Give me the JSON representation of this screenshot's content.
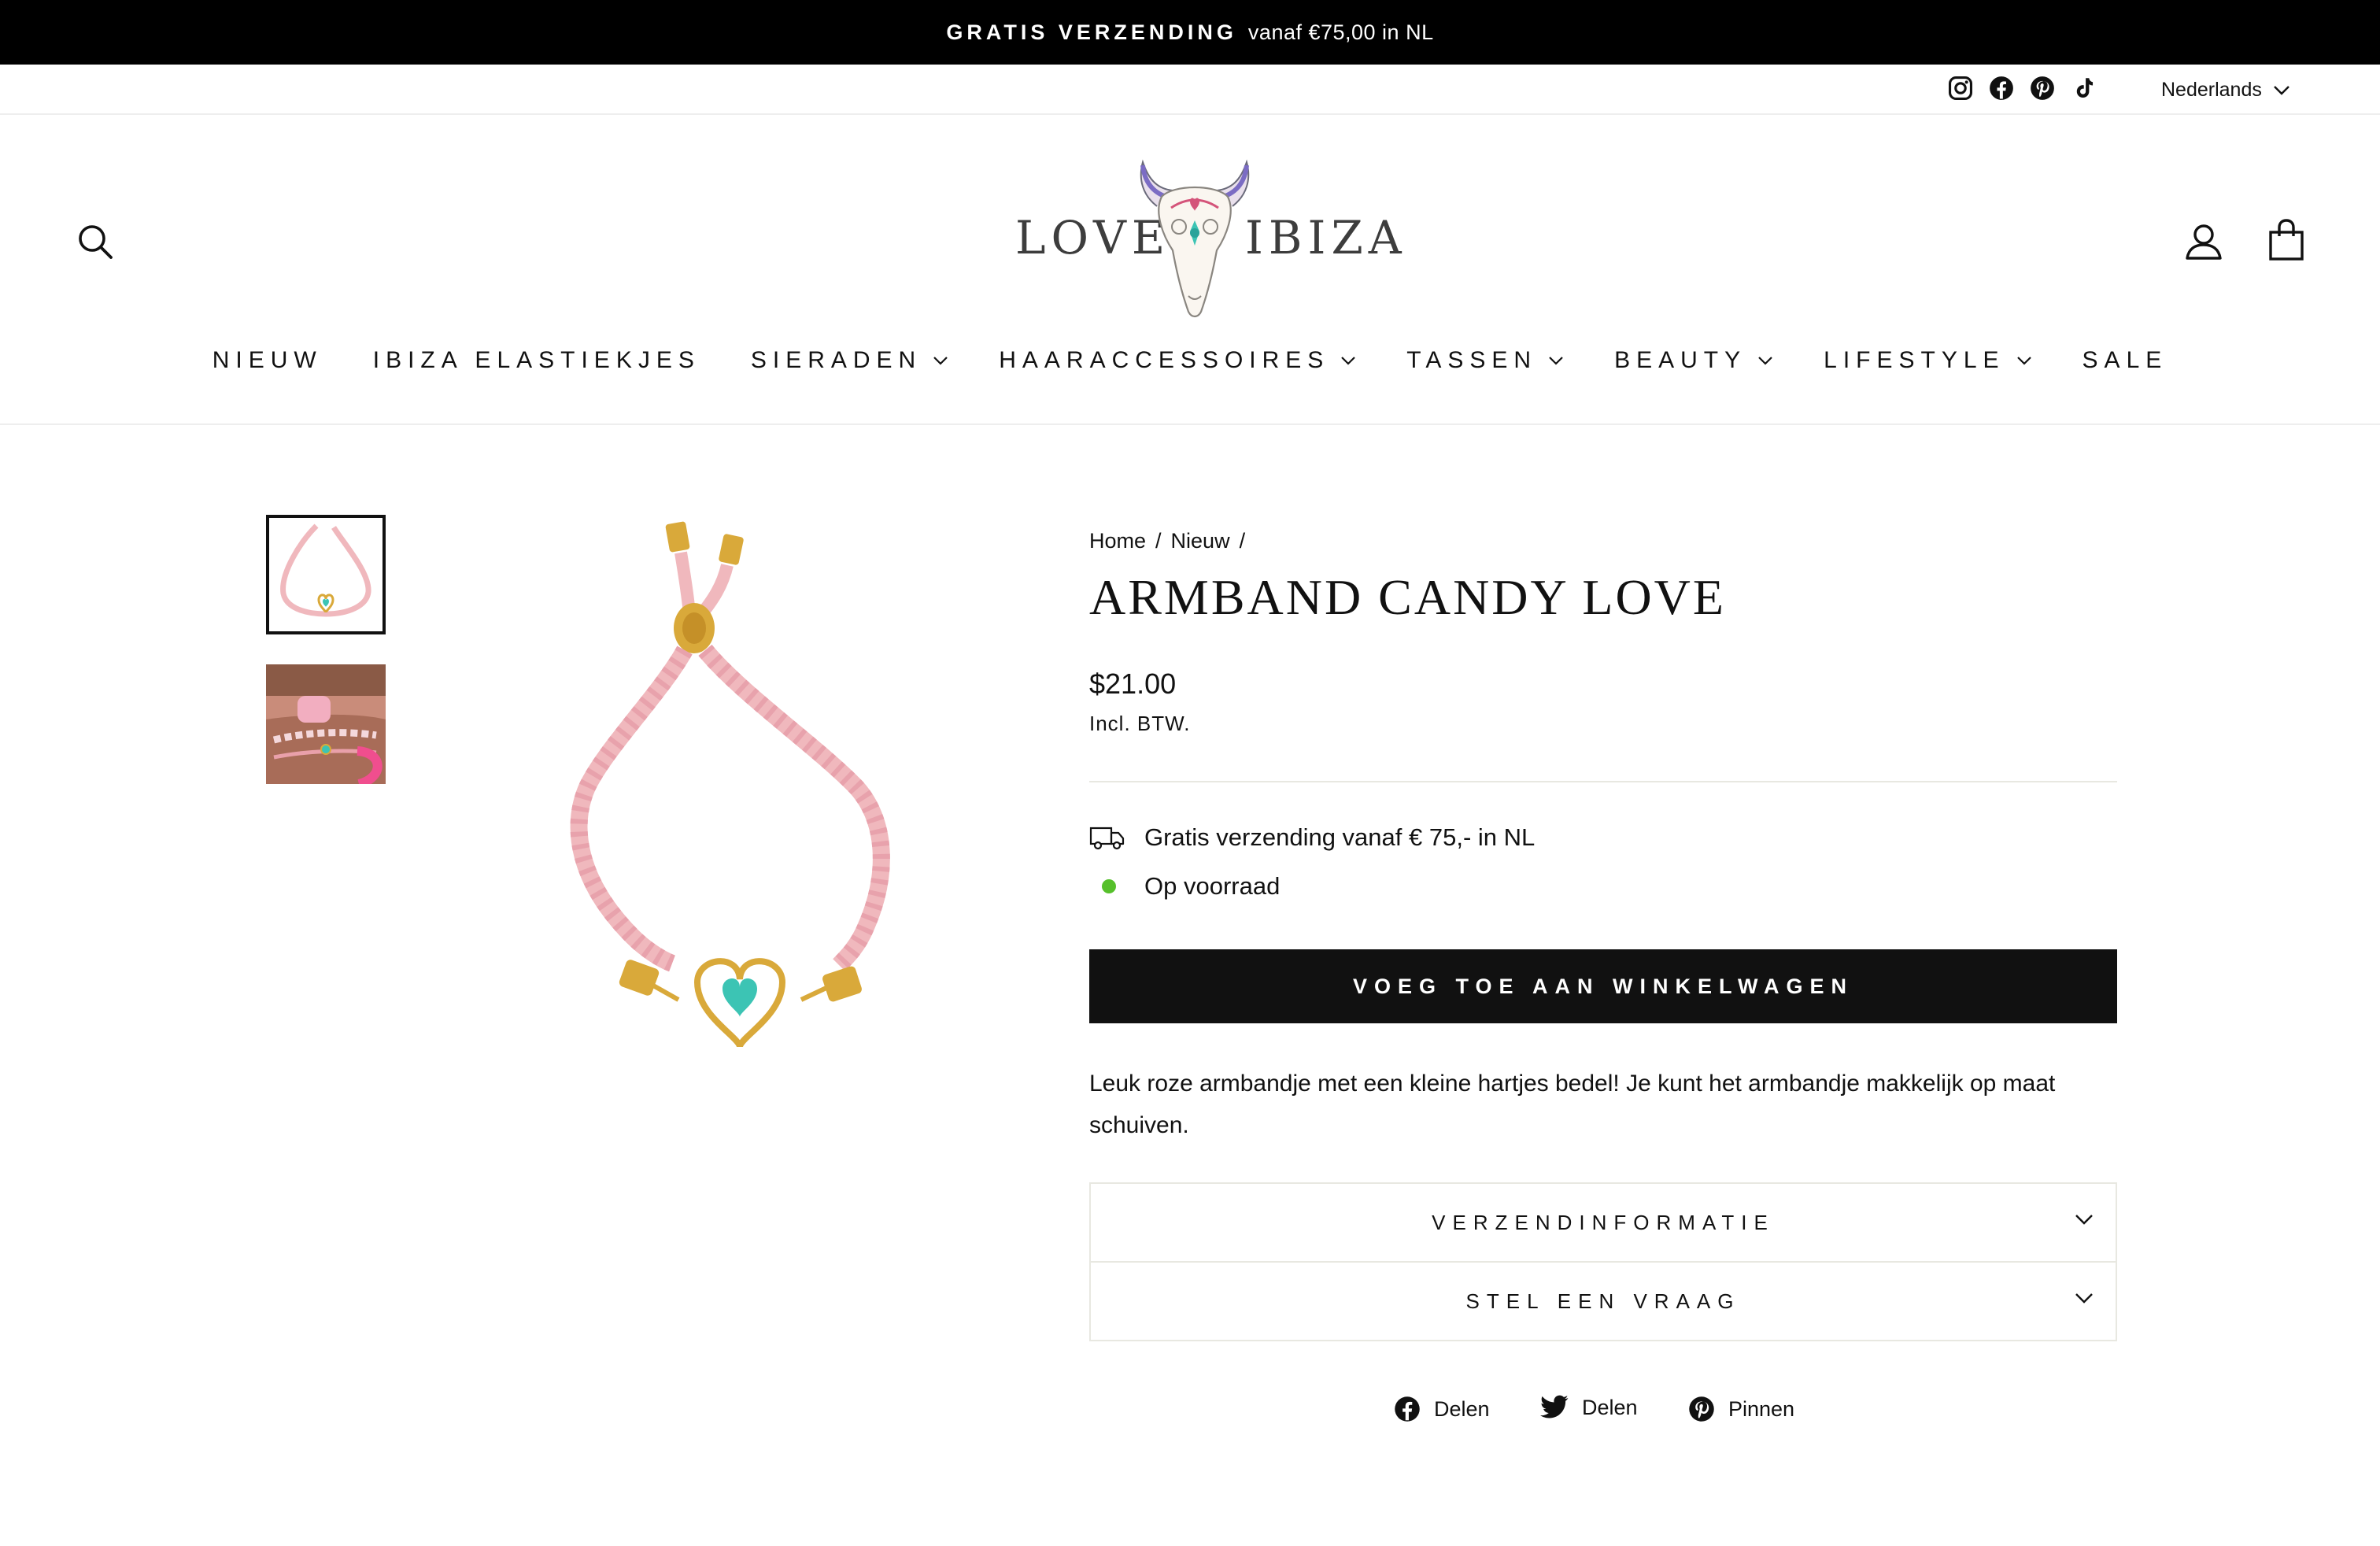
{
  "announcement": {
    "strong": "GRATIS VERZENDING",
    "rest": "vanaf €75,00 in NL"
  },
  "utility": {
    "social_icons": [
      "instagram-icon",
      "facebook-icon",
      "pinterest-icon",
      "tiktok-icon"
    ],
    "language": "Nederlands"
  },
  "header": {
    "logo_left": "LOVE",
    "logo_right": "IBIZA",
    "icons": [
      "search-icon",
      "account-icon",
      "cart-icon"
    ]
  },
  "nav": {
    "items": [
      {
        "label": "NIEUW",
        "dropdown": false
      },
      {
        "label": "IBIZA ELASTIEKJES",
        "dropdown": false
      },
      {
        "label": "SIERADEN",
        "dropdown": true
      },
      {
        "label": "HAARACCESSOIRES",
        "dropdown": true
      },
      {
        "label": "TASSEN",
        "dropdown": true
      },
      {
        "label": "BEAUTY",
        "dropdown": true
      },
      {
        "label": "LIFESTYLE",
        "dropdown": true
      },
      {
        "label": "SALE",
        "dropdown": false
      }
    ]
  },
  "product": {
    "breadcrumb": {
      "home": "Home",
      "sep": "/",
      "category": "Nieuw"
    },
    "title": "ARMBAND CANDY LOVE",
    "price": "$21.00",
    "tax_note": "Incl. BTW.",
    "shipping_note": "Gratis verzending vanaf € 75,- in NL",
    "stock": "Op voorraad",
    "add_to_cart": "VOEG TOE AAN WINKELWAGEN",
    "description": "Leuk roze armbandje met een kleine hartjes bedel! Je kunt het armbandje makkelijk op maat schuiven.",
    "accordions": [
      {
        "label": "VERZENDINFORMATIE"
      },
      {
        "label": "STEL EEN VRAAG"
      }
    ],
    "share": [
      {
        "icon": "facebook-icon",
        "label": "Delen"
      },
      {
        "icon": "twitter-icon",
        "label": "Delen"
      },
      {
        "icon": "pinterest-icon",
        "label": "Pinnen"
      }
    ]
  },
  "colors": {
    "announcement_bg": "#000000",
    "button_bg": "#111111",
    "in_stock": "#56c02b",
    "cord_pink": "#f0b8bd",
    "gold": "#d9a93a",
    "heart_teal": "#3cc4b4"
  }
}
